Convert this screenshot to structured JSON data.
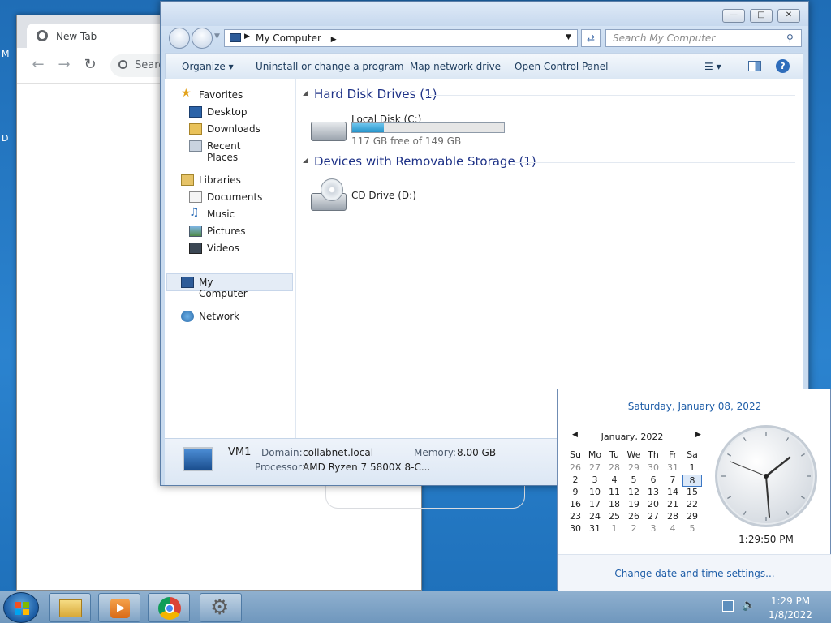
{
  "chrome": {
    "tab_title": "New Tab",
    "omnibox_placeholder": "Searc"
  },
  "explorer": {
    "breadcrumb": "My Computer",
    "search_placeholder": "Search My Computer",
    "toolbar": {
      "organize": "Organize",
      "uninstall": "Uninstall or change a program",
      "map_drive": "Map network drive",
      "control_panel": "Open Control Panel"
    },
    "nav": {
      "favorites": "Favorites",
      "desktop": "Desktop",
      "downloads": "Downloads",
      "recent": "Recent Places",
      "libraries": "Libraries",
      "documents": "Documents",
      "music": "Music",
      "pictures": "Pictures",
      "videos": "Videos",
      "computer": "My Computer",
      "network": "Network"
    },
    "groups": {
      "hdd_header": "Hard Disk Drives (1)",
      "removable_header": "Devices with Removable Storage (1)"
    },
    "drives": {
      "c_name": "Local Disk (C:)",
      "c_free": "117 GB free of 149 GB",
      "c_used_fraction": 0.21,
      "d_name": "CD Drive (D:)"
    },
    "details": {
      "computer_name": "VM1",
      "domain_label": "Domain:",
      "domain_value": "collabnet.local",
      "memory_label": "Memory:",
      "memory_value": "8.00 GB",
      "processor_label": "Processor:",
      "processor_value": "AMD Ryzen 7 5800X 8-C..."
    }
  },
  "flyout": {
    "long_date": "Saturday, January 08, 2022",
    "month": "January, 2022",
    "weekdays": [
      "Su",
      "Mo",
      "Tu",
      "We",
      "Th",
      "Fr",
      "Sa"
    ],
    "weeks": [
      [
        "26",
        "27",
        "28",
        "29",
        "30",
        "31",
        "1"
      ],
      [
        "2",
        "3",
        "4",
        "5",
        "6",
        "7",
        "8"
      ],
      [
        "9",
        "10",
        "11",
        "12",
        "13",
        "14",
        "15"
      ],
      [
        "16",
        "17",
        "18",
        "19",
        "20",
        "21",
        "22"
      ],
      [
        "23",
        "24",
        "25",
        "26",
        "27",
        "28",
        "29"
      ],
      [
        "30",
        "31",
        "1",
        "2",
        "3",
        "4",
        "5"
      ]
    ],
    "selected_day": "8",
    "clock_time": "1:29:50 PM",
    "change_link": "Change date and time settings..."
  },
  "taskbar": {
    "time": "1:29 PM",
    "date": "1/8/2022"
  },
  "colors": {
    "accent": "#1f5ea8",
    "header_blue": "#1e3287",
    "progress": "#35a4d6"
  }
}
